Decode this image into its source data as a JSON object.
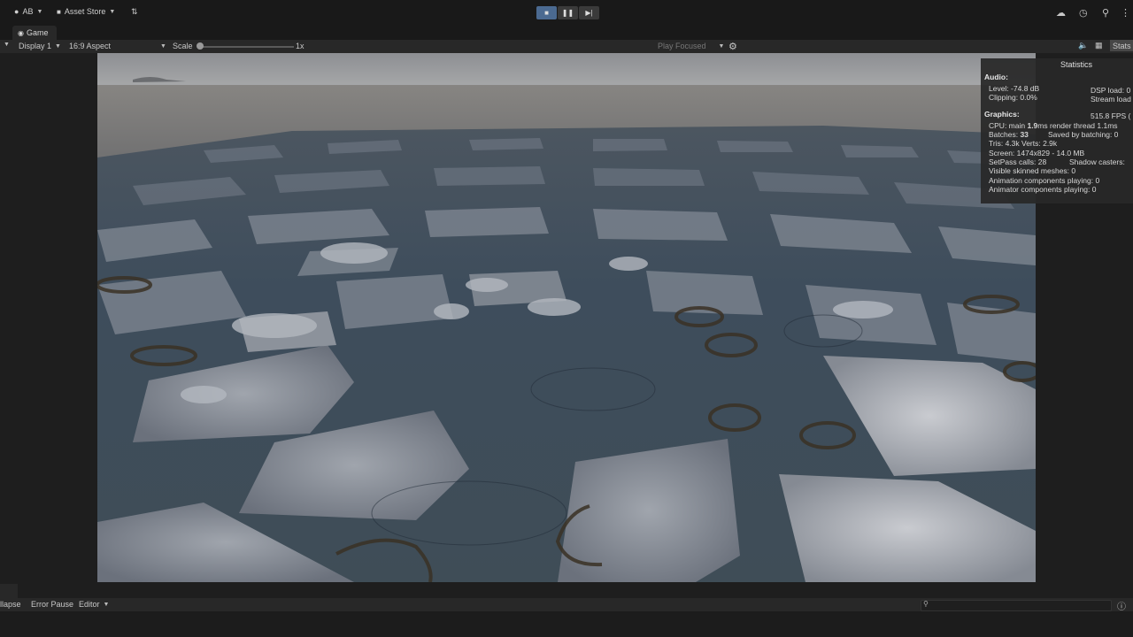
{
  "toolbar": {
    "account_label": "AB",
    "asset_store_label": "Asset Store"
  },
  "game_tab": {
    "label": "Game"
  },
  "game_bar": {
    "display_label": "Display 1",
    "aspect_label": "16:9 Aspect",
    "scale_label": "Scale",
    "scale_value": "1x",
    "play_focused_label": "Play Focused",
    "stats_button_label": "Stats"
  },
  "stats": {
    "title": "Statistics",
    "audio_header": "Audio:",
    "level": "Level: -74.8 dB",
    "clipping": "Clipping: 0.0%",
    "dsp_load": "DSP load: 0",
    "stream_load": "Stream load",
    "graphics_header": "Graphics:",
    "fps": "515.8 FPS (",
    "cpu_prefix": "CPU: main ",
    "cpu_main": "1.9",
    "cpu_suffix": "ms  render thread 1.1ms",
    "batches_prefix": "Batches: ",
    "batches_value": "33",
    "saved_by_batching": "Saved by batching: 0",
    "tris_verts": "Tris: 4.3k  Verts: 2.9k",
    "screen": "Screen: 1474x829 - 14.0 MB",
    "setpass_calls": "SetPass calls: 28",
    "shadow_casters": "Shadow casters:",
    "visible_skinned_meshes": "Visible skinned meshes: 0",
    "animation_components": "Animation components playing: 0",
    "animator_components": "Animator components playing: 0"
  },
  "console": {
    "collapse_label": "llapse",
    "error_pause_label": "Error Pause",
    "editor_label": "Editor"
  },
  "colors": {
    "play_active": "#4b6a91",
    "panel_dark": "#191919",
    "panel_mid": "#282828"
  }
}
